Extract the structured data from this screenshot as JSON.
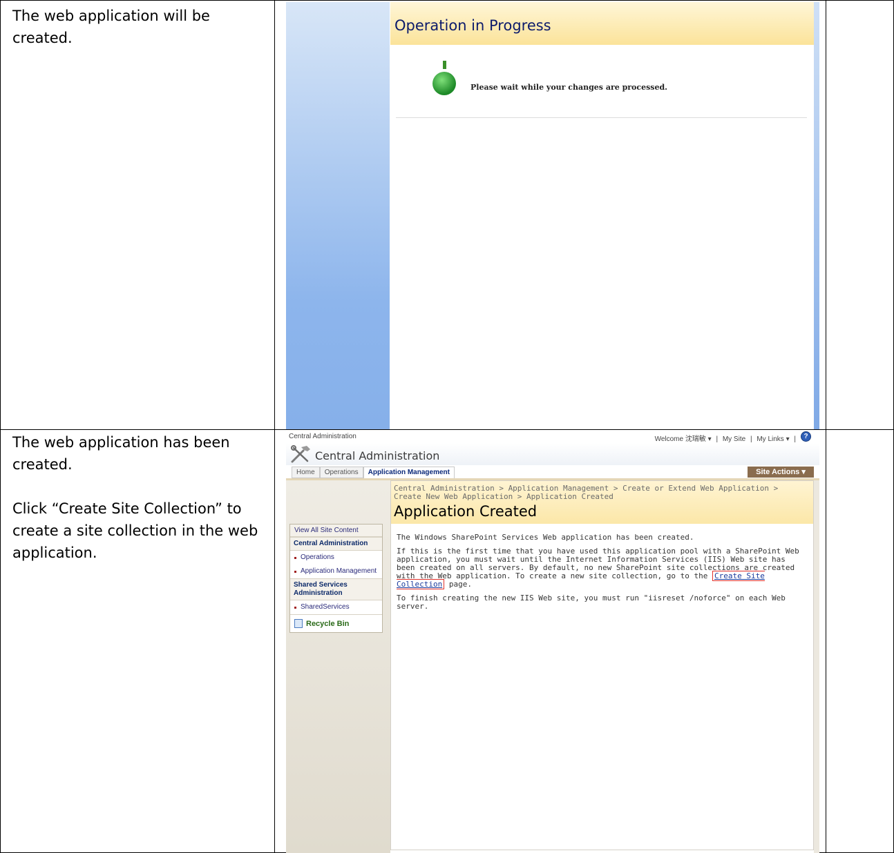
{
  "rows": [
    {
      "instruction": [
        "The web application will be created."
      ]
    },
    {
      "instruction": [
        "The web application has been created.",
        "Click “Create Site Collection” to create a site collection in the web application."
      ]
    }
  ],
  "shot1": {
    "header_title": "Operation in Progress",
    "wait_message": "Please wait while your changes are processed.",
    "progress_icon": "green-pin-icon"
  },
  "shot2": {
    "top_crumb": "Central Administration",
    "welcome": "Welcome 沈瑞敏 ▾",
    "my_site": "My Site",
    "my_links": "My Links ▾",
    "help_icon": "help-icon",
    "site_title": "Central Administration",
    "tabs": [
      "Home",
      "Operations",
      "Application Management"
    ],
    "site_actions": "Site Actions ▾",
    "breadcrumb": "Central Administration > Application Management > Create or Extend Web Application > Create New Web Application > Application Created",
    "page_title": "Application Created",
    "body_1": "The Windows SharePoint Services Web application has been created.",
    "body_2_pre": "If this is the first time that you have used this application pool with a SharePoint Web application, you must wait until the Internet Information Services (IIS) Web site has been created on all servers. By default, no new SharePoint site collections are created with the Web application. To create a new site collection, go to the",
    "body_2_link": "Create Site Collection",
    "body_2_post": "page.",
    "body_3": "To finish creating the new IIS Web site, you must run \"iisreset /noforce\" on each Web server.",
    "nav": {
      "view_all": "View All Site Content",
      "section1": "Central Administration",
      "section1_items": [
        "Operations",
        "Application Management"
      ],
      "section2": "Shared Services Administration",
      "section2_items": [
        "SharedServices"
      ],
      "recycle": "Recycle Bin"
    }
  }
}
